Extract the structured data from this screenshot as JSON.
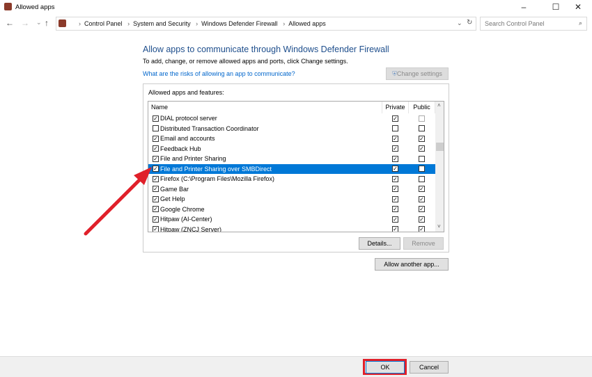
{
  "window": {
    "title": "Allowed apps",
    "minimize": "–",
    "maximize": "☐",
    "close": "✕"
  },
  "nav": {
    "back": "←",
    "forward": "→",
    "recent": "⌄",
    "up": "↑",
    "refresh": "↻",
    "dropdown": "⌄"
  },
  "breadcrumb": [
    "Control Panel",
    "System and Security",
    "Windows Defender Firewall",
    "Allowed apps"
  ],
  "search": {
    "placeholder": "Search Control Panel"
  },
  "main": {
    "heading": "Allow apps to communicate through Windows Defender Firewall",
    "subtitle": "To add, change, or remove allowed apps and ports, click Change settings.",
    "risk_link": "What are the risks of allowing an app to communicate?",
    "change_settings": "Change settings",
    "group_label": "Allowed apps and features:",
    "columns": {
      "name": "Name",
      "private": "Private",
      "public": "Public"
    },
    "rows": [
      {
        "name": "DIAL protocol server",
        "enabled": true,
        "private": true,
        "public": false
      },
      {
        "name": "Distributed Transaction Coordinator",
        "enabled": false,
        "private": false,
        "public": false
      },
      {
        "name": "Email and accounts",
        "enabled": true,
        "private": true,
        "public": true
      },
      {
        "name": "Feedback Hub",
        "enabled": true,
        "private": true,
        "public": true
      },
      {
        "name": "File and Printer Sharing",
        "enabled": true,
        "private": true,
        "public": false
      },
      {
        "name": "File and Printer Sharing over SMBDirect",
        "enabled": true,
        "private": true,
        "public": false,
        "selected": true
      },
      {
        "name": "Firefox (C:\\Program Files\\Mozilla Firefox)",
        "enabled": true,
        "private": true,
        "public": false
      },
      {
        "name": "Game Bar",
        "enabled": true,
        "private": true,
        "public": true
      },
      {
        "name": "Get Help",
        "enabled": true,
        "private": true,
        "public": true
      },
      {
        "name": "Google Chrome",
        "enabled": true,
        "private": true,
        "public": true
      },
      {
        "name": "Hitpaw (AI-Center)",
        "enabled": true,
        "private": true,
        "public": true
      },
      {
        "name": "Hitpaw (ZNCJ Server)",
        "enabled": true,
        "private": true,
        "public": true
      }
    ],
    "details": "Details...",
    "remove": "Remove",
    "allow_another": "Allow another app..."
  },
  "footer": {
    "ok": "OK",
    "cancel": "Cancel"
  },
  "colors": {
    "highlight": "#0078d7",
    "annotation": "#e0202a"
  }
}
